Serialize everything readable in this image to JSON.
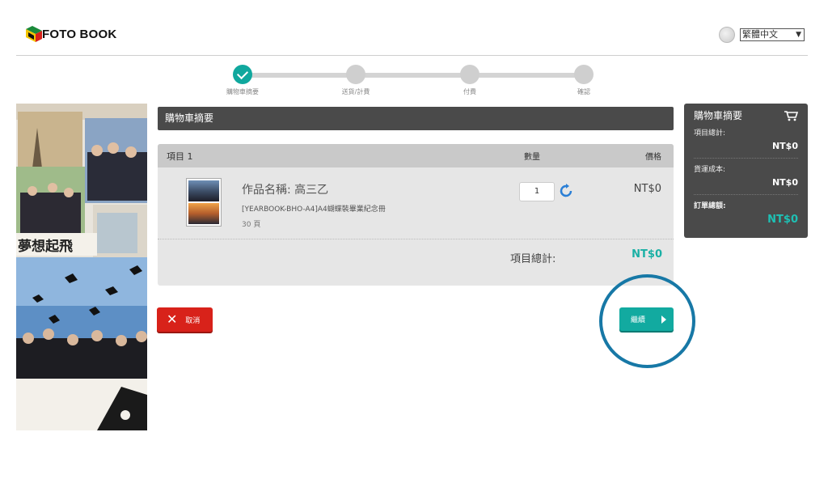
{
  "header": {
    "logo_text": "FOTO BOOK",
    "language_selected": "繁體中文"
  },
  "steps": [
    {
      "label": "購物車摘要",
      "state": "done"
    },
    {
      "label": "送貨/計費",
      "state": "pending"
    },
    {
      "label": "付費",
      "state": "pending"
    },
    {
      "label": "確認",
      "state": "pending"
    }
  ],
  "banner": {
    "text": "夢想起飛"
  },
  "main": {
    "title": "購物車摘要",
    "table": {
      "col_item": "項目 1",
      "col_qty": "數量",
      "col_price": "價格"
    },
    "item": {
      "name": "作品名稱: 高三乙",
      "code": "[YEARBOOK-BHO-A4]A4蝴蝶裝畢業紀念冊",
      "pages": "30 頁",
      "quantity": "1",
      "price": "NT$0"
    },
    "subtotal_label": "項目總計:",
    "subtotal_value": "NT$0",
    "cancel_label": "取消",
    "continue_label": "繼續"
  },
  "summary": {
    "title": "購物車摘要",
    "items_total_label": "項目總計:",
    "items_total_value": "NT$0",
    "shipping_label": "貨運成本:",
    "shipping_value": "NT$0",
    "order_total_label": "訂單總額:",
    "order_total_value": "NT$0"
  },
  "colors": {
    "accent": "#10a89e",
    "danger": "#d8221a",
    "dark_panel": "#4a4a4a",
    "ring": "#1778a6"
  },
  "icons": {
    "step_done": "check-icon",
    "refresh": "refresh-icon",
    "cart": "cart-icon",
    "globe": "globe-icon",
    "cancel": "close-icon",
    "continue": "play-arrow-icon"
  }
}
